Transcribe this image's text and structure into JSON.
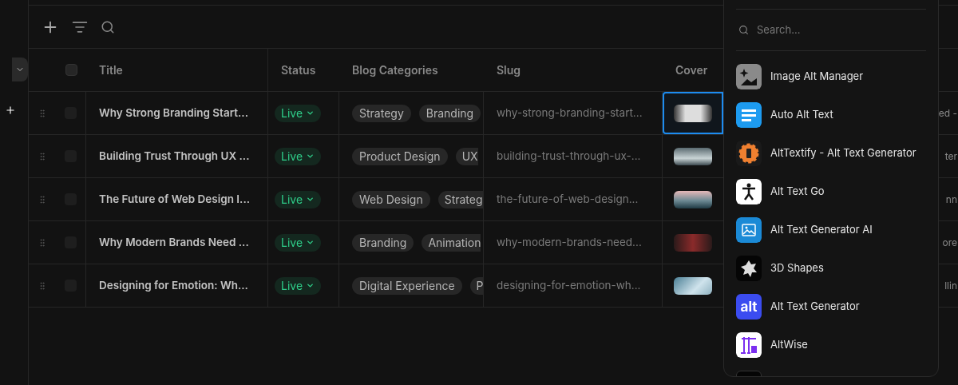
{
  "table": {
    "select_all_checked": false,
    "columns": [
      "Title",
      "Status",
      "Blog Categories",
      "Slug",
      "Cover"
    ],
    "rows": [
      {
        "checked": false,
        "title": "Why Strong Branding Start...",
        "status": "Live",
        "categories": [
          {
            "label": "Strategy",
            "cut": false
          },
          {
            "label": "Branding",
            "cut": false
          }
        ],
        "slug": "why-strong-branding-start...",
        "cover_selected": true,
        "column_6": "ed -"
      },
      {
        "checked": false,
        "title": "Building Trust Through UX ...",
        "status": "Live",
        "categories": [
          {
            "label": "Product Design",
            "cut": false
          },
          {
            "label": "UX",
            "cut": true
          }
        ],
        "slug": "building-trust-through-ux-...",
        "cover_selected": false,
        "column_6": "ter"
      },
      {
        "checked": false,
        "title": "The Future of Web Design I...",
        "status": "Live",
        "categories": [
          {
            "label": "Web Design",
            "cut": false
          },
          {
            "label": "Strateg",
            "cut": true
          }
        ],
        "slug": "the-future-of-web-design...",
        "cover_selected": false,
        "column_6": "nn"
      },
      {
        "checked": false,
        "title": "Why Modern Brands Need ...",
        "status": "Live",
        "categories": [
          {
            "label": "Branding",
            "cut": false
          },
          {
            "label": "Animation",
            "cut": true
          }
        ],
        "slug": "why-modern-brands-need...",
        "cover_selected": false,
        "column_6": "ore"
      },
      {
        "checked": false,
        "title": "Designing for Emotion: Wh...",
        "status": "Live",
        "categories": [
          {
            "label": "Digital Experience",
            "cut": false
          },
          {
            "label": "P",
            "cut": true
          }
        ],
        "slug": "designing-for-emotion-wh...",
        "cover_selected": false,
        "column_6": "llin"
      }
    ]
  },
  "popover": {
    "search_placeholder": "Search...",
    "items": [
      {
        "label": "Image Alt Manager"
      },
      {
        "label": "Auto Alt Text"
      },
      {
        "label": "AltTextify - Alt Text Generator"
      },
      {
        "label": "Alt Text Go"
      },
      {
        "label": "Alt Text Generator AI"
      },
      {
        "label": "3D Shapes"
      },
      {
        "label": "Alt Text Generator",
        "icon_text": "alt"
      },
      {
        "label": "AltWise"
      }
    ]
  }
}
